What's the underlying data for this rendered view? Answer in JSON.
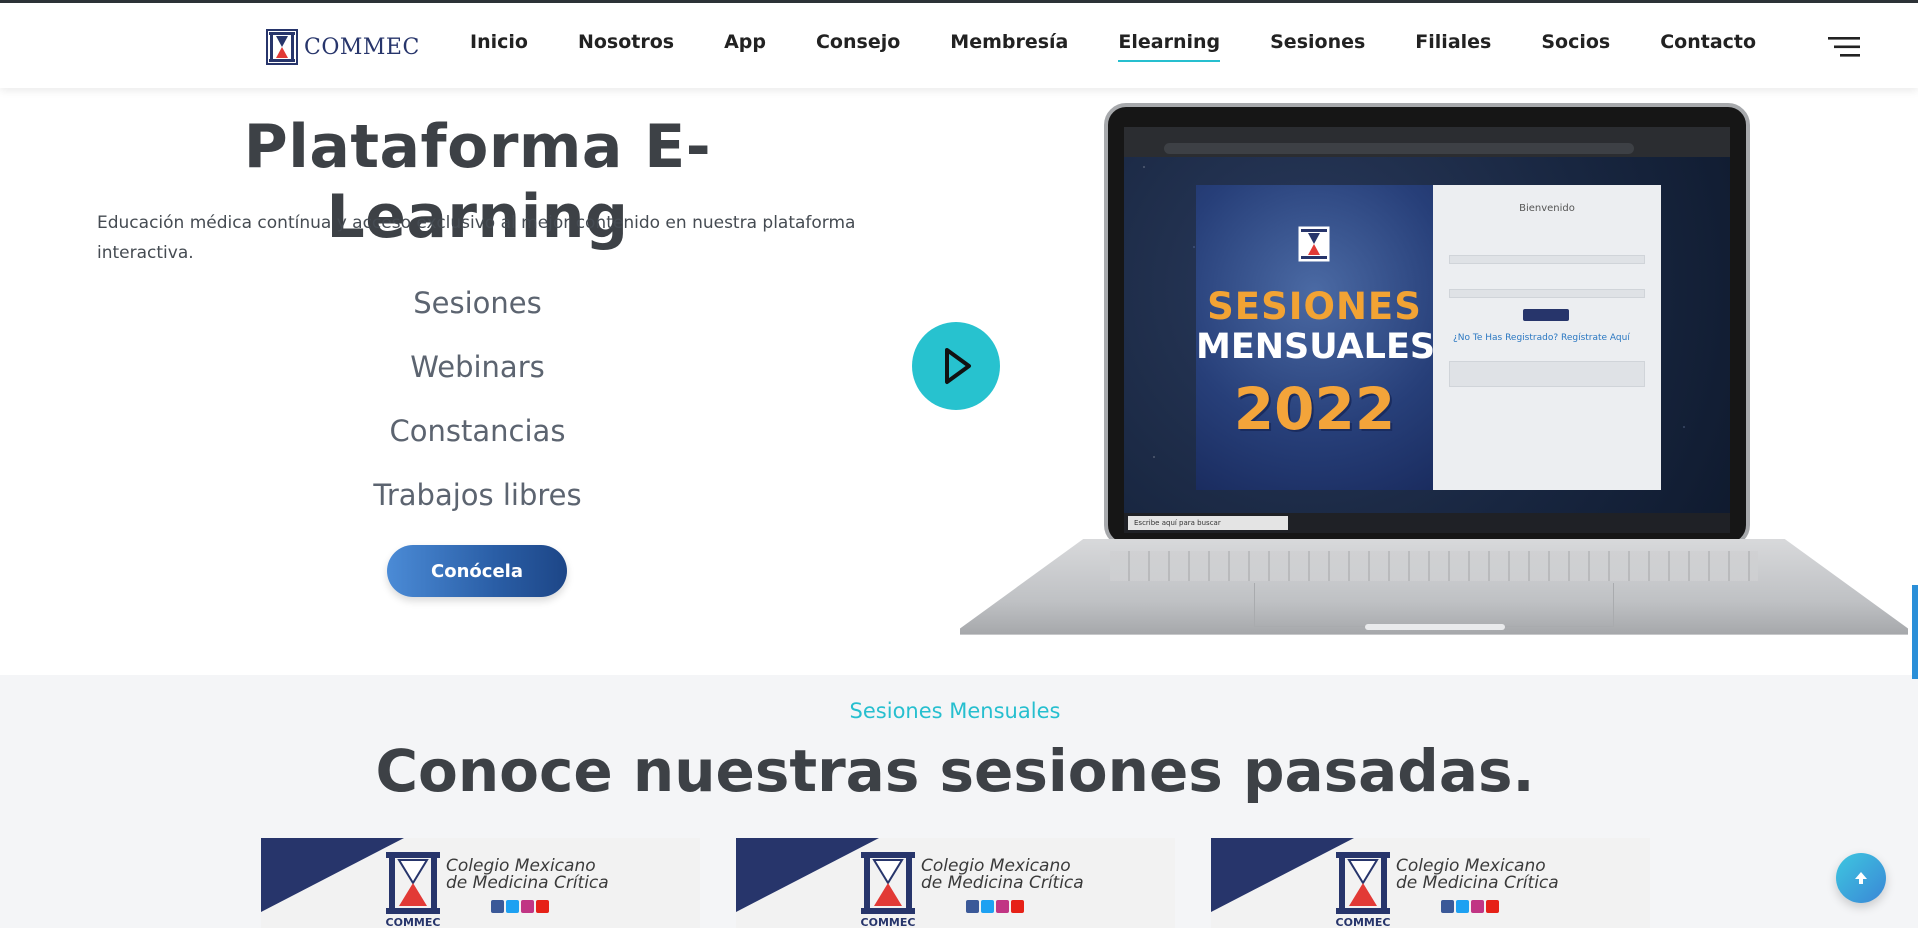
{
  "brand": {
    "name": "COMMEC",
    "color": "#27356b",
    "accent": "#26bfcf"
  },
  "nav": {
    "items": [
      {
        "label": "Inicio"
      },
      {
        "label": "Nosotros"
      },
      {
        "label": "App"
      },
      {
        "label": "Consejo"
      },
      {
        "label": "Membresía"
      },
      {
        "label": "Elearning",
        "active": true
      },
      {
        "label": "Sesiones"
      },
      {
        "label": "Filiales"
      },
      {
        "label": "Socios"
      },
      {
        "label": "Contacto"
      }
    ],
    "menu_icon": "hamburger-menu-icon"
  },
  "hero": {
    "title": "Plataforma E-Learning",
    "description": "Educación médica contínua y acceso exclusivo al mejor contenido en nuestra plataforma interactiva.",
    "features": [
      "Sesiones",
      "Webinars",
      "Constancias",
      "Trabajos libres"
    ],
    "cta_label": "Conócela",
    "play_icon": "play-icon"
  },
  "video_preview": {
    "poster_line1": "SESIONES",
    "poster_line2": "MENSUALES",
    "poster_line3": "2022",
    "login_title": "Bienvenido",
    "login_register": "¿No Te Has Registrado? Regístrate Aquí",
    "taskbar_search": "Escribe aquí para buscar"
  },
  "sessions": {
    "kicker": "Sesiones Mensuales",
    "title": "Conoce nuestras sesiones pasadas.",
    "cards": [
      {
        "org_line1": "Colegio Mexicano",
        "org_line2": "de Medicina Crítica",
        "logo_text": "COMMEC"
      },
      {
        "org_line1": "Colegio Mexicano",
        "org_line2": "de Medicina Crítica",
        "logo_text": "COMMEC"
      },
      {
        "org_line1": "Colegio Mexicano",
        "org_line2": "de Medicina Crítica",
        "logo_text": "COMMEC"
      }
    ]
  },
  "scroll_top_icon": "arrow-up-icon"
}
